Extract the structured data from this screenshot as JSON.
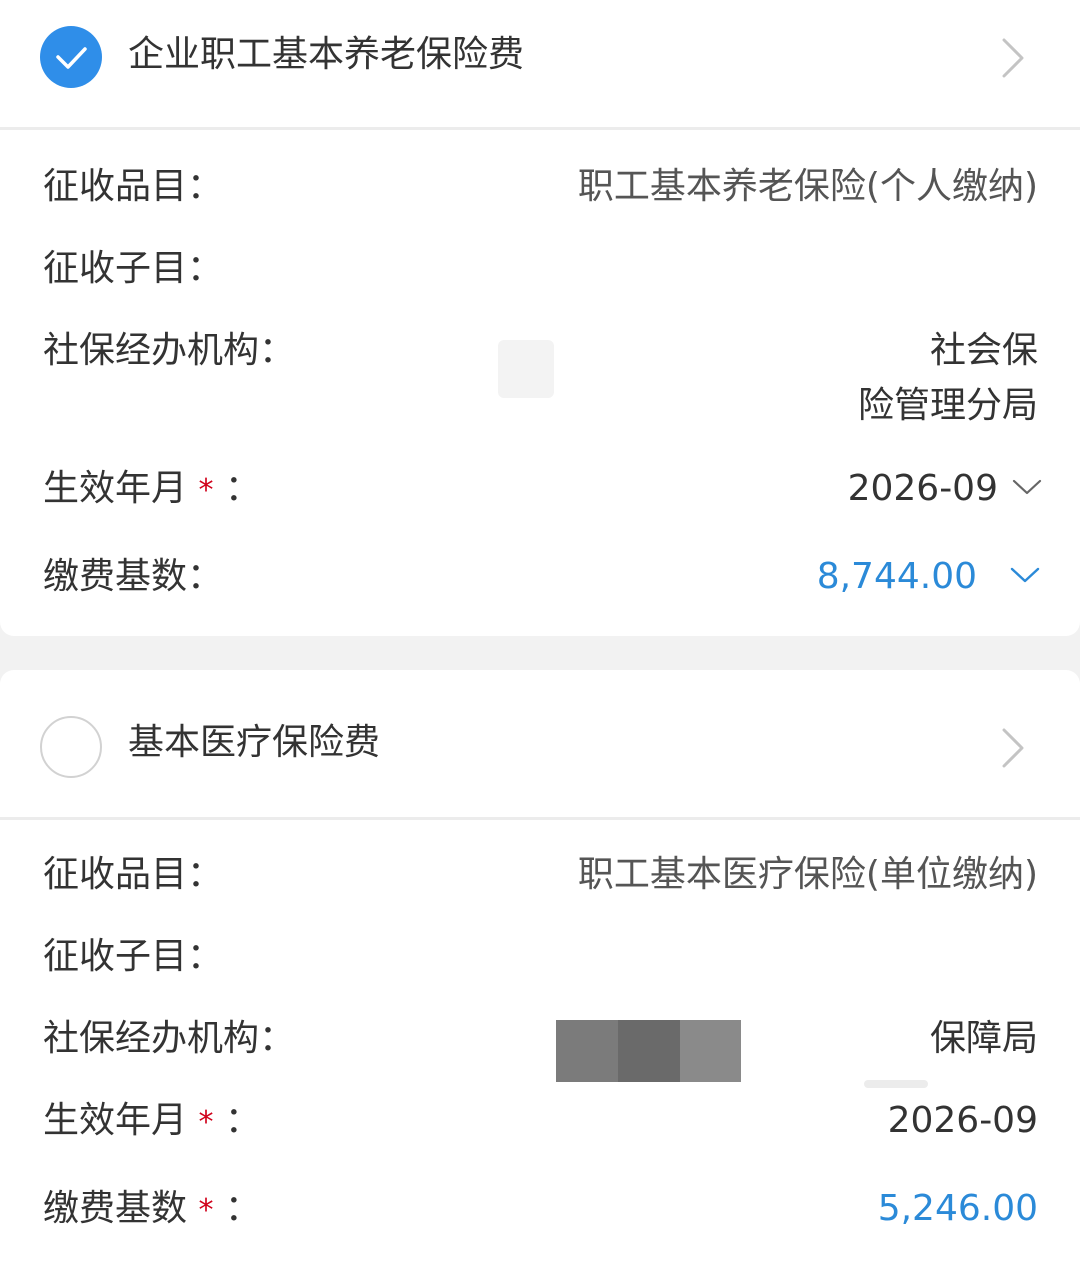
{
  "sections": [
    {
      "title": "企业职工基本养老保险费",
      "checked": true,
      "fields": {
        "category_label": "征收品目：",
        "category_value": "职工基本养老保险(个人缴纳)",
        "subcategory_label": "征收子目：",
        "agency_label": "社保经办机构：",
        "agency_value_line1": "社会保",
        "agency_value_line2": "险管理分局",
        "effective_label": "生效年月",
        "effective_value": "2026-09",
        "base_label": "缴费基数：",
        "base_value": "8,744.00"
      }
    },
    {
      "title": "基本医疗保险费",
      "checked": false,
      "fields": {
        "category_label": "征收品目：",
        "category_value": "职工基本医疗保险(单位缴纳)",
        "subcategory_label": "征收子目：",
        "agency_label": "社保经办机构：",
        "agency_value": "保障局",
        "effective_label": "生效年月",
        "effective_value": "2026-09",
        "base_label": "缴费基数",
        "base_value": "5,246.00"
      }
    }
  ],
  "required_mark": "*",
  "colon": "：",
  "colors": {
    "accent_blue": "#2f8ee9",
    "value_blue": "#2b8ad8",
    "required_red": "#d0021b"
  },
  "icons": {
    "check": "check-icon",
    "chevron_right": "chevron-right-icon",
    "chevron_down": "chevron-down-icon"
  }
}
